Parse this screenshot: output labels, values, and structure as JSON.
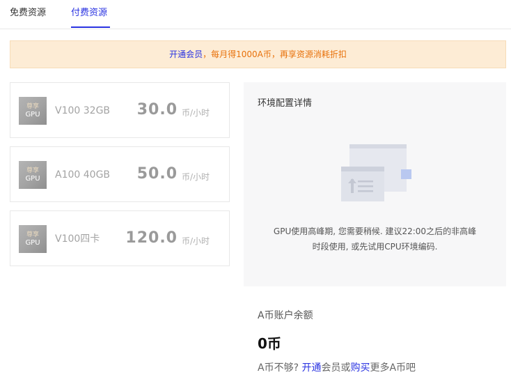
{
  "tabs": {
    "free_label": "免费资源",
    "paid_label": "付费资源",
    "active": "付费资源"
  },
  "banner": {
    "link_text": "开通会员",
    "separator": "，",
    "rest_text": "每月得1000A币，再享资源消耗折扣"
  },
  "resources": [
    {
      "badge_top": "尊享",
      "badge_bottom": "GPU",
      "name": "V100 32GB",
      "price": "30.0",
      "unit": "币/小时"
    },
    {
      "badge_top": "尊享",
      "badge_bottom": "GPU",
      "name": "A100 40GB",
      "price": "50.0",
      "unit": "币/小时"
    },
    {
      "badge_top": "尊享",
      "badge_bottom": "GPU",
      "name": "V100四卡",
      "price": "120.0",
      "unit": "币/小时"
    }
  ],
  "environment": {
    "title": "环境配置详情",
    "message_line1": "GPU使用高峰期, 您需要稍候. 建议22:00之后的非高峰",
    "message_line2": "时段使用, 或先试用CPU环境编码."
  },
  "balance": {
    "title": "A币账户余额",
    "value": "0币",
    "tip_prefix": "A币不够? ",
    "tip_link1": "开通",
    "tip_middle": "会员或",
    "tip_link2": "购买",
    "tip_suffix": "更多A币吧"
  },
  "colors": {
    "accent": "#2932e1",
    "banner_bg": "#fdecd5",
    "banner_text": "#e8710a",
    "panel_bg": "#f7f7f8"
  }
}
